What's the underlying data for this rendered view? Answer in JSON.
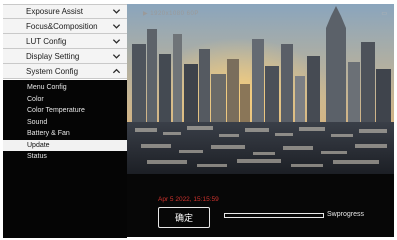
{
  "menu": {
    "items": [
      {
        "label": "Exposure Assist",
        "chevron": "down"
      },
      {
        "label": "Focus&Composition",
        "chevron": "down"
      },
      {
        "label": "LUT Config",
        "chevron": "down"
      },
      {
        "label": "Display Setting",
        "chevron": "down"
      },
      {
        "label": "System Config",
        "chevron": "up"
      }
    ]
  },
  "submenu": {
    "items": [
      {
        "label": "Menu Config"
      },
      {
        "label": "Color"
      },
      {
        "label": "Color Temperature"
      },
      {
        "label": "Sound"
      },
      {
        "label": "Battery & Fan"
      },
      {
        "label": "Update",
        "selected": true
      },
      {
        "label": "Status"
      }
    ]
  },
  "preview": {
    "top_left_text": "▶ 1920x1080 60P",
    "top_right_icon": "battery-icon",
    "datetime": "Apr 5 2022, 15:15:59",
    "confirm_label": "确定",
    "progress_label": "Swprogress",
    "progress_value": 0
  },
  "colors": {
    "menu_bg": "#f4f4f4",
    "submenu_bg": "#050505",
    "selected_bg": "#f2f2f2",
    "datetime": "#d0332e"
  }
}
